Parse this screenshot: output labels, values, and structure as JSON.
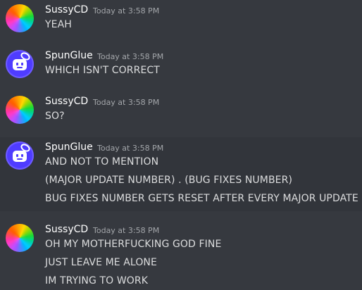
{
  "messages": [
    {
      "author": "SussyCD",
      "timestamp": "Today at 3:58 PM",
      "avatar": "rainbow-avatar",
      "lines": [
        "YEAH"
      ]
    },
    {
      "author": "SpunGlue",
      "timestamp": "Today at 3:58 PM",
      "avatar": "bot-avatar",
      "lines": [
        "WHICH ISN'T CORRECT"
      ]
    },
    {
      "author": "SussyCD",
      "timestamp": "Today at 3:58 PM",
      "avatar": "rainbow-avatar",
      "lines": [
        "SO?"
      ]
    },
    {
      "author": "SpunGlue",
      "timestamp": "Today at 3:58 PM",
      "avatar": "bot-avatar",
      "lines": [
        "AND NOT TO MENTION",
        "(MAJOR UPDATE NUMBER) . (BUG FIXES NUMBER)",
        "BUG FIXES NUMBER GETS RESET AFTER EVERY MAJOR UPDATE"
      ]
    },
    {
      "author": "SussyCD",
      "timestamp": "Today at 3:58 PM",
      "avatar": "rainbow-avatar",
      "lines": [
        "OH MY MOTHERFUCKING GOD FINE",
        "JUST LEAVE ME ALONE",
        "IM TRYING TO WORK"
      ]
    }
  ],
  "colors": {
    "background": "#36393f",
    "highlight": "#32353b",
    "username": "#ffffff",
    "timestamp": "#a3a6aa",
    "text": "#dcddde"
  }
}
